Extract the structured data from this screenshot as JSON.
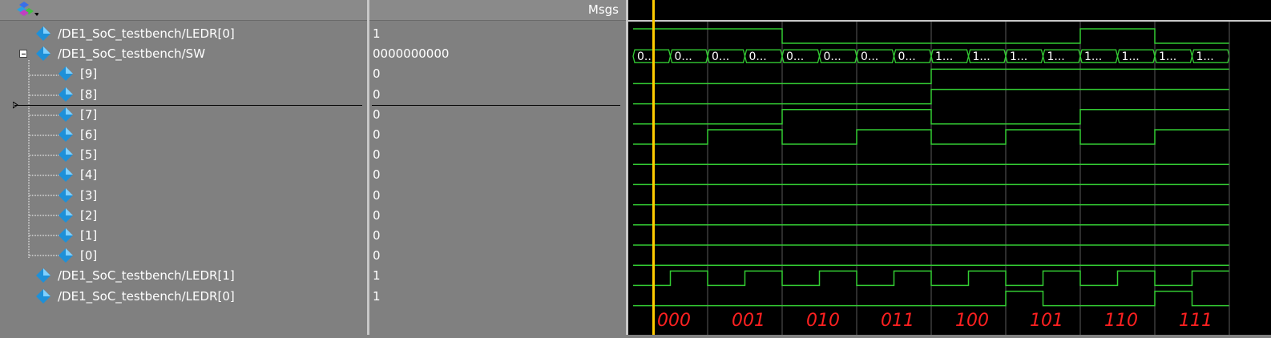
{
  "toolbar": {
    "icon": "wave-add-icon",
    "msgs_label": "Msgs"
  },
  "signals": [
    {
      "name": "/DE1_SoC_testbench/LEDR[0]",
      "value": "1"
    },
    {
      "name": "/DE1_SoC_testbench/SW",
      "value": "0000000000"
    },
    {
      "name": "[9]",
      "value": "0"
    },
    {
      "name": "[8]",
      "value": "0"
    },
    {
      "name": "[7]",
      "value": "0"
    },
    {
      "name": "[6]",
      "value": "0"
    },
    {
      "name": "[5]",
      "value": "0"
    },
    {
      "name": "[4]",
      "value": "0"
    },
    {
      "name": "[3]",
      "value": "0"
    },
    {
      "name": "[2]",
      "value": "0"
    },
    {
      "name": "[1]",
      "value": "0"
    },
    {
      "name": "[0]",
      "value": "0"
    },
    {
      "name": "/DE1_SoC_testbench/LEDR[1]",
      "value": "1"
    },
    {
      "name": "/DE1_SoC_testbench/LEDR[0]",
      "value": "1"
    }
  ],
  "bus_labels": [
    "0...",
    "0...",
    "0...",
    "0...",
    "0...",
    "0...",
    "0...",
    "0...",
    "1...",
    "1...",
    "1...",
    "1...",
    "1...",
    "1...",
    "1...",
    "1..."
  ],
  "handwritten_labels": [
    "000",
    "001",
    "010",
    "011",
    "100",
    "101",
    "110",
    "111"
  ],
  "colors": {
    "wave": "#33cc33",
    "cursor": "#ffcc00",
    "grid": "#5a5a5a",
    "annot": "#ff2020",
    "icon": "#2aa0e0"
  }
}
